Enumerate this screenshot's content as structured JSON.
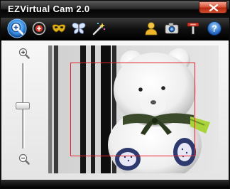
{
  "window": {
    "title": "EZVirtual Cam 2.0"
  },
  "toolbar": {
    "items": [
      {
        "icon": "zoom-icon",
        "label": ""
      },
      {
        "icon": "add-icon",
        "label": ""
      },
      {
        "icon": "mask-icon",
        "label": ""
      },
      {
        "icon": "butterfly-icon",
        "label": ""
      },
      {
        "icon": "magic-wand-icon",
        "label": ""
      },
      {
        "icon": "user-icon",
        "label": ""
      },
      {
        "icon": "camera-icon",
        "label": ""
      },
      {
        "icon": "tools-icon",
        "label": ""
      },
      {
        "icon": "help-icon",
        "label": ""
      }
    ]
  },
  "zoom": {
    "level": 0.5,
    "in_icon": "zoom-in-icon",
    "out_icon": "zoom-out-icon"
  },
  "preview": {
    "content": "teddy bear webcam preview",
    "selection_color": "#e8202a"
  },
  "colors": {
    "titlebar": "#1a1a1a",
    "close_button": "#d14b2c",
    "accent_blue": "#2d7fd8"
  }
}
